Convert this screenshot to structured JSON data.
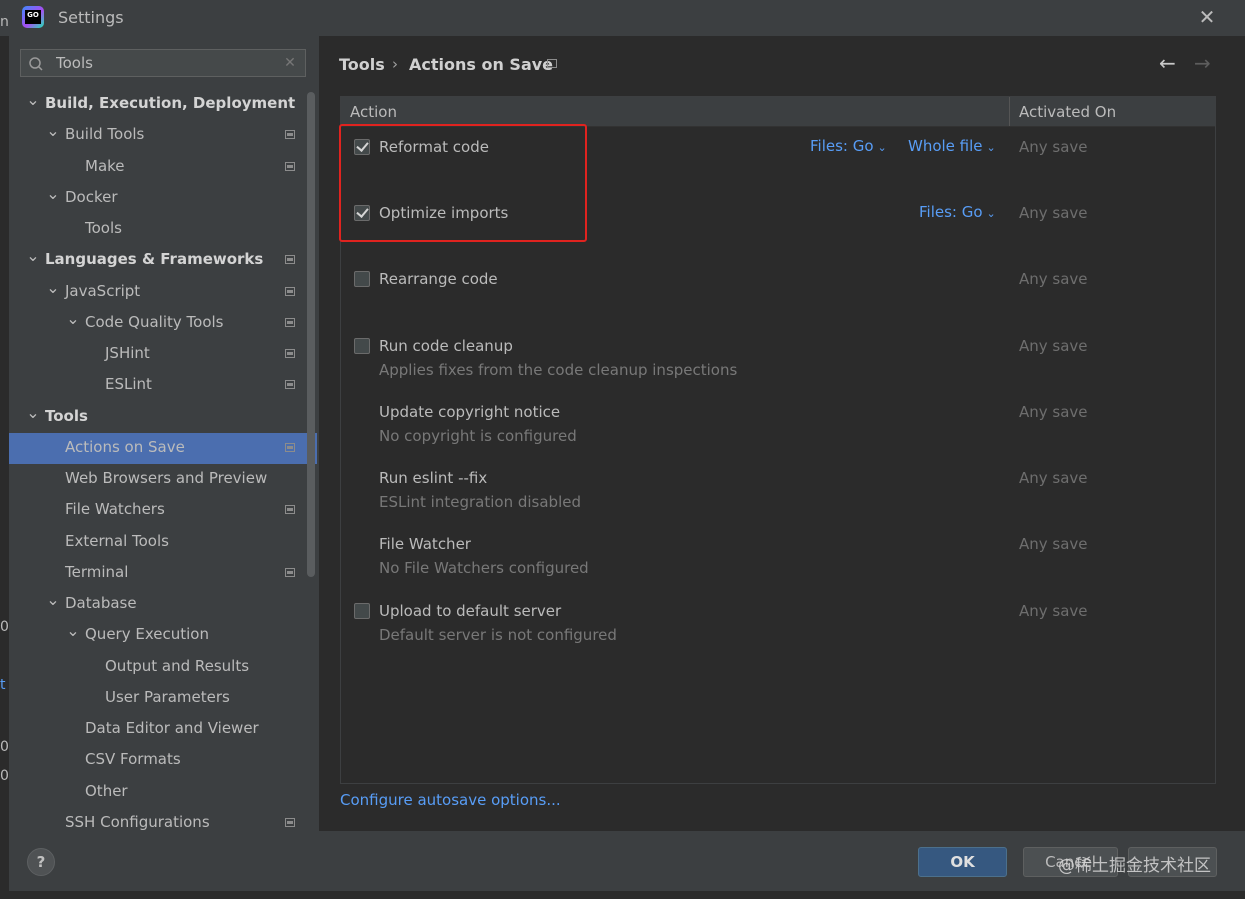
{
  "window": {
    "title": "Settings",
    "app_icon_text": "GO",
    "close_icon": "close-icon"
  },
  "outer_strip": {
    "chars": [
      "n",
      "0",
      "t",
      "0",
      "0"
    ]
  },
  "search": {
    "value": "Tools",
    "placeholder": ""
  },
  "tree": [
    {
      "label": "Build, Execution, Deployment",
      "bold": true,
      "expanded": true,
      "indent": 0,
      "page_icon": false
    },
    {
      "label": "Build Tools",
      "bold": false,
      "expanded": true,
      "indent": 1,
      "page_icon": true
    },
    {
      "label": "Make",
      "bold": false,
      "expanded": null,
      "indent": 2,
      "page_icon": true
    },
    {
      "label": "Docker",
      "bold": false,
      "expanded": true,
      "indent": 1,
      "page_icon": false
    },
    {
      "label": "Tools",
      "bold": false,
      "expanded": null,
      "indent": 2,
      "page_icon": false
    },
    {
      "label": "Languages & Frameworks",
      "bold": true,
      "expanded": true,
      "indent": 0,
      "page_icon": true
    },
    {
      "label": "JavaScript",
      "bold": false,
      "expanded": true,
      "indent": 1,
      "page_icon": true
    },
    {
      "label": "Code Quality Tools",
      "bold": false,
      "expanded": true,
      "indent": 2,
      "page_icon": true
    },
    {
      "label": "JSHint",
      "bold": false,
      "expanded": null,
      "indent": 3,
      "page_icon": true
    },
    {
      "label": "ESLint",
      "bold": false,
      "expanded": null,
      "indent": 3,
      "page_icon": true
    },
    {
      "label": "Tools",
      "bold": true,
      "expanded": true,
      "indent": 0,
      "page_icon": false
    },
    {
      "label": "Actions on Save",
      "bold": false,
      "expanded": null,
      "indent": 1,
      "page_icon": true,
      "selected": true
    },
    {
      "label": "Web Browsers and Preview",
      "bold": false,
      "expanded": null,
      "indent": 1,
      "page_icon": false
    },
    {
      "label": "File Watchers",
      "bold": false,
      "expanded": null,
      "indent": 1,
      "page_icon": true
    },
    {
      "label": "External Tools",
      "bold": false,
      "expanded": null,
      "indent": 1,
      "page_icon": false
    },
    {
      "label": "Terminal",
      "bold": false,
      "expanded": null,
      "indent": 1,
      "page_icon": true
    },
    {
      "label": "Database",
      "bold": false,
      "expanded": true,
      "indent": 1,
      "page_icon": false
    },
    {
      "label": "Query Execution",
      "bold": false,
      "expanded": true,
      "indent": 2,
      "page_icon": false
    },
    {
      "label": "Output and Results",
      "bold": false,
      "expanded": null,
      "indent": 3,
      "page_icon": false
    },
    {
      "label": "User Parameters",
      "bold": false,
      "expanded": null,
      "indent": 3,
      "page_icon": false
    },
    {
      "label": "Data Editor and Viewer",
      "bold": false,
      "expanded": null,
      "indent": 2,
      "page_icon": false
    },
    {
      "label": "CSV Formats",
      "bold": false,
      "expanded": null,
      "indent": 2,
      "page_icon": false
    },
    {
      "label": "Other",
      "bold": false,
      "expanded": null,
      "indent": 2,
      "page_icon": false
    },
    {
      "label": "SSH Configurations",
      "bold": false,
      "expanded": null,
      "indent": 1,
      "page_icon": true
    }
  ],
  "breadcrumb": {
    "parent": "Tools",
    "separator": "›",
    "current": "Actions on Save",
    "back_icon": "back-arrow-icon",
    "forward_icon": "forward-arrow-icon"
  },
  "table": {
    "col_action": "Action",
    "col_activated": "Activated On",
    "rows": [
      {
        "label": "Reformat code",
        "checkbox": true,
        "checked": true,
        "subtitle": "",
        "links": [
          "Files: Go",
          "Whole file"
        ],
        "activated": "Any save"
      },
      {
        "label": "Optimize imports",
        "checkbox": true,
        "checked": true,
        "subtitle": "",
        "links": [
          "Files: Go"
        ],
        "activated": "Any save"
      },
      {
        "label": "Rearrange code",
        "checkbox": true,
        "checked": false,
        "subtitle": "",
        "links": [],
        "activated": "Any save"
      },
      {
        "label": "Run code cleanup",
        "checkbox": true,
        "checked": false,
        "subtitle": "Applies fixes from the code cleanup inspections",
        "links": [],
        "activated": "Any save"
      },
      {
        "label": "Update copyright notice",
        "checkbox": false,
        "checked": false,
        "subtitle": "No copyright is configured",
        "links": [],
        "activated": "Any save"
      },
      {
        "label": "Run eslint --fix",
        "checkbox": false,
        "checked": false,
        "subtitle": "ESLint integration disabled",
        "links": [],
        "activated": "Any save"
      },
      {
        "label": "File Watcher",
        "checkbox": false,
        "checked": false,
        "subtitle": "No File Watchers configured",
        "links": [],
        "activated": "Any save"
      },
      {
        "label": "Upload to default server",
        "checkbox": true,
        "checked": false,
        "subtitle": "Default server is not configured",
        "links": [],
        "activated": "Any save"
      }
    ]
  },
  "autosave_link": "Configure autosave options...",
  "buttons": {
    "help": "?",
    "ok": "OK",
    "cancel": "Cancel",
    "apply": ""
  },
  "watermark": "@稀土掘金技术社区",
  "colors": {
    "accent": "#589df6",
    "selection": "#4b6eaf",
    "highlight_box": "#e0231f",
    "ok_button": "#365880"
  }
}
